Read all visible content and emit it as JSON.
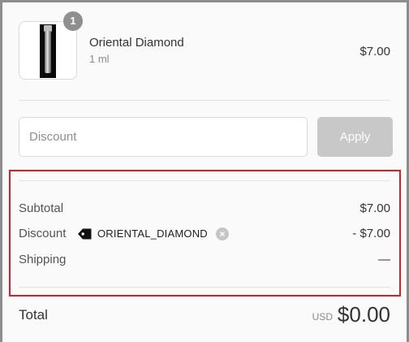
{
  "product": {
    "quantity": "1",
    "name": "Oriental Diamond",
    "variant": "1 ml",
    "price": "$7.00"
  },
  "discount_form": {
    "placeholder": "Discount",
    "value": "",
    "apply_label": "Apply"
  },
  "summary": {
    "subtotal_label": "Subtotal",
    "subtotal_value": "$7.00",
    "discount_label": "Discount",
    "discount_code": "ORIENTAL_DIAMOND",
    "discount_value": "- $7.00",
    "shipping_label": "Shipping",
    "shipping_value": "—"
  },
  "total": {
    "label": "Total",
    "currency": "USD",
    "amount": "$0.00"
  },
  "icons": {
    "code_tag": "tag-icon",
    "remove_code": "close-circle-icon"
  },
  "colors": {
    "highlight_border": "#d4202a",
    "apply_button": "#c8c8c8",
    "quantity_badge": "#8f8f8f"
  }
}
